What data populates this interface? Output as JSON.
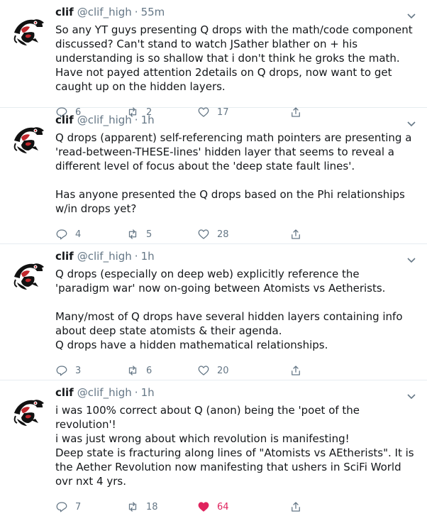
{
  "tweets": [
    {
      "name": "clif",
      "handle": "@clif_high",
      "time": "55m",
      "text": "So any YT guys presenting Q drops with the math/code component discussed? Can't stand to watch JSather blather on + his understanding is so shallow that i don't think he groks the math. Have not payed attention 2details on Q drops, now want to get caught up on the hidden layers.",
      "replies": "6",
      "retweets": "2",
      "likes": "17",
      "liked": false
    },
    {
      "name": "clif",
      "handle": "@clif_high",
      "time": "1h",
      "text": "Q drops (apparent) self-referencing math pointers are presenting a 'read-between-THESE-lines' hidden layer that seems to reveal a different level of focus about the 'deep state fault lines'.\n\nHas anyone presented the Q drops based on the Phi relationships w/in drops yet?",
      "replies": "4",
      "retweets": "5",
      "likes": "28",
      "liked": false
    },
    {
      "name": "clif",
      "handle": "@clif_high",
      "time": "1h",
      "text": "Q drops (especially on deep web) explicitly reference the 'paradigm war' now on-going between Atomists vs Aetherists.\n\nMany/most of Q drops have several hidden layers containing info about deep state atomists & their agenda.\nQ drops have a hidden mathematical relationships.",
      "replies": "3",
      "retweets": "6",
      "likes": "20",
      "liked": false
    },
    {
      "name": "clif",
      "handle": "@clif_high",
      "time": "1h",
      "text": "i was 100% correct about Q (anon) being the 'poet of the  revolution'!\ni was just wrong about which revolution is manifesting!\nDeep state is fracturing along lines of \"Atomists vs AEtherists\". It is the Aether Revolution now manifesting that ushers in SciFi World ovr nxt 4 yrs.",
      "replies": "7",
      "retweets": "18",
      "likes": "64",
      "liked": true
    }
  ],
  "meta_separator": "·",
  "colors": {
    "text": "#14171a",
    "secondary": "#657786",
    "like_active": "#e0245e",
    "border": "#e6ecf0"
  },
  "icons": {
    "reply": "reply-icon",
    "retweet": "retweet-icon",
    "like": "heart-icon",
    "share": "share-icon",
    "more": "chevron-down-icon",
    "avatar": "raven-totem-avatar"
  }
}
